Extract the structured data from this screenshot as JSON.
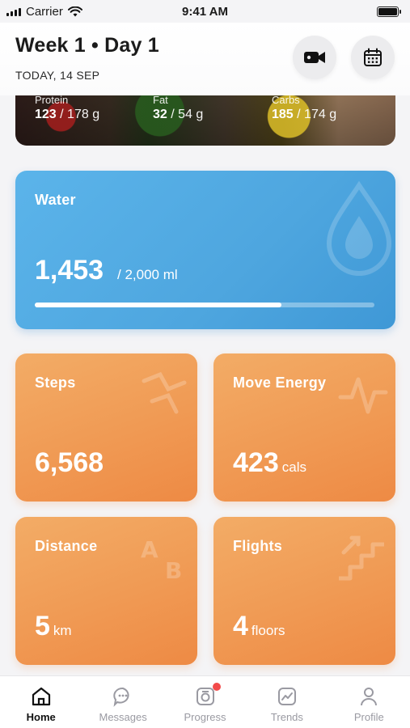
{
  "status_bar": {
    "carrier": "Carrier",
    "time": "9:41 AM"
  },
  "header": {
    "title": "Week 1 • Day 1",
    "date": "TODAY, 14 SEP"
  },
  "macros": [
    {
      "label": "Protein",
      "value": "123",
      "goal": "/ 178 g"
    },
    {
      "label": "Fat",
      "value": "32",
      "goal": "/ 54 g"
    },
    {
      "label": "Carbs",
      "value": "185",
      "goal": "/ 174 g"
    }
  ],
  "water": {
    "title": "Water",
    "value": "1,453",
    "goal": "/  2,000 ml",
    "progress": 0.7265,
    "color": "#4ea6df"
  },
  "steps": {
    "title": "Steps",
    "value": "6,568"
  },
  "move_energy": {
    "title": "Move Energy",
    "value": "423",
    "unit": "cals"
  },
  "distance": {
    "title": "Distance",
    "value": "5",
    "unit": "km"
  },
  "flights": {
    "title": "Flights",
    "value": "4",
    "unit": "floors"
  },
  "tabs": [
    {
      "label": "Home",
      "icon": "home-icon",
      "active": true
    },
    {
      "label": "Messages",
      "icon": "chat-icon"
    },
    {
      "label": "Progress",
      "icon": "camera-icon",
      "badge": true
    },
    {
      "label": "Trends",
      "icon": "trend-icon"
    },
    {
      "label": "Profile",
      "icon": "person-icon"
    }
  ],
  "colors": {
    "orange_card": "#f09a54",
    "water_card": "#4ea6df",
    "badge": "#f24a4a"
  }
}
